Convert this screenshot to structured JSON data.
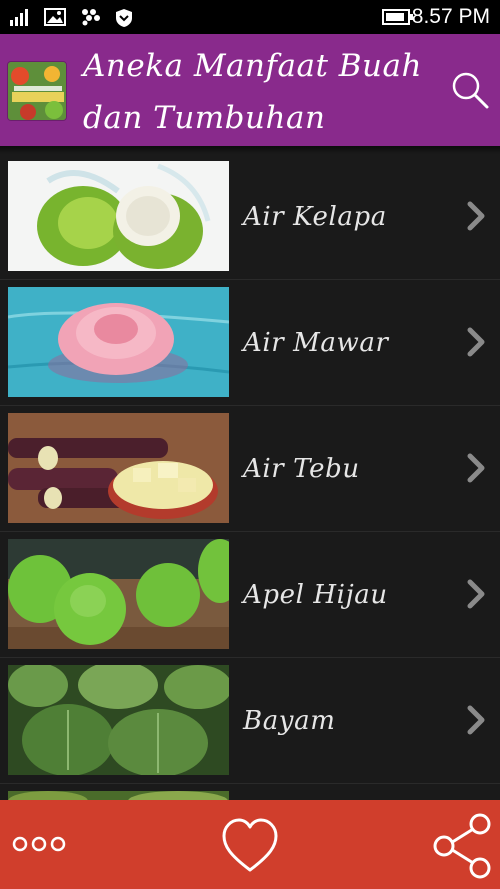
{
  "status_bar": {
    "time": "8.57 PM",
    "icons": [
      "signal-icon",
      "gallery-icon",
      "bbm-icon",
      "shield-icon",
      "battery-icon"
    ]
  },
  "header": {
    "title": "Aneka Manfaat Buah dan Tumbuhan",
    "search_icon": "search-icon"
  },
  "items": [
    {
      "label": "Air Kelapa",
      "image": "coconut-water-photo"
    },
    {
      "label": "Air Mawar",
      "image": "rose-water-photo"
    },
    {
      "label": "Air Tebu",
      "image": "sugarcane-photo"
    },
    {
      "label": "Apel Hijau",
      "image": "green-apple-photo"
    },
    {
      "label": "Bayam",
      "image": "spinach-photo"
    }
  ],
  "bottom_bar": {
    "more_icon": "more-dots-icon",
    "favorite_icon": "heart-icon",
    "share_icon": "share-icon"
  },
  "colors": {
    "header": "#892a8c",
    "list_bg": "#1a1a1a",
    "bottom_bar": "#d03e2c"
  }
}
